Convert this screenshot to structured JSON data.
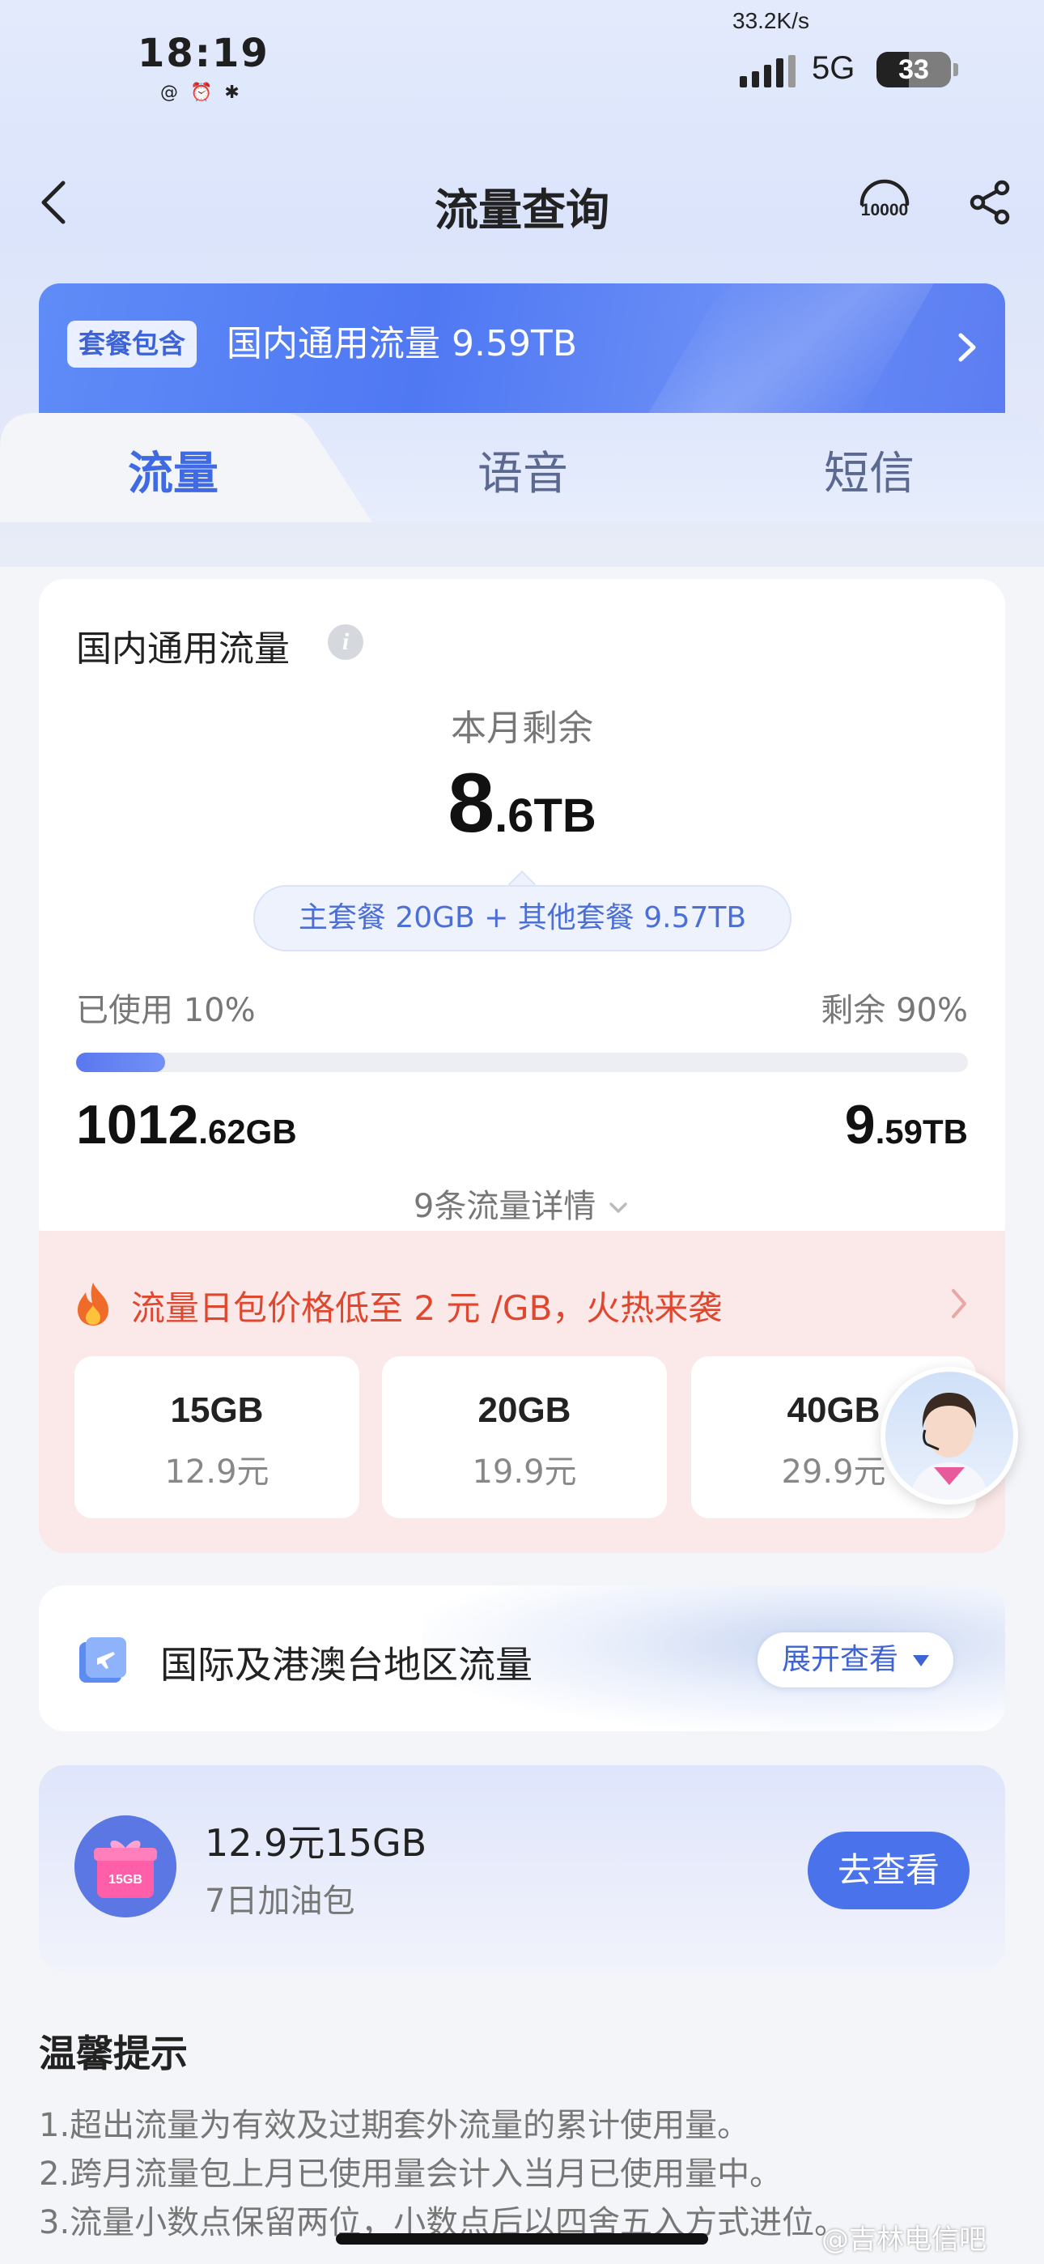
{
  "status_bar": {
    "time": "18:19",
    "left_icons": "@ ⏰ ✱",
    "speed": "33.2K/s",
    "network": "5G",
    "battery": "33"
  },
  "nav": {
    "title": "流量查询",
    "icons": [
      "back-arrow-icon",
      "customer-service-10000-icon",
      "share-icon"
    ]
  },
  "banner": {
    "tag": "套餐包含",
    "text": "国内通用流量 9.59TB"
  },
  "tabs": [
    {
      "label": "流量",
      "active": true
    },
    {
      "label": "语音",
      "active": false
    },
    {
      "label": "短信",
      "active": false
    }
  ],
  "usage_card": {
    "title": "国内通用流量",
    "remaining_label": "本月剩余",
    "remaining_int": "8",
    "remaining_rest": ".6TB",
    "breakdown": "主套餐 20GB + 其他套餐 9.57TB",
    "used_label": "已使用 10%",
    "remain_label": "剩余 90%",
    "used_fraction": 0.1,
    "used_int": "1012",
    "used_rest": ".62GB",
    "total_int": "9",
    "total_rest": ".59TB",
    "details_link": "9条流量详情"
  },
  "promo": {
    "text": "流量日包价格低至 2 元 /GB，火热来袭",
    "packages": [
      {
        "size": "15GB",
        "price": "12.9元"
      },
      {
        "size": "20GB",
        "price": "19.9元"
      },
      {
        "size": "40GB",
        "price": "29.9元"
      }
    ]
  },
  "international": {
    "title": "国际及港澳台地区流量",
    "button": "展开查看"
  },
  "booster": {
    "title": "12.9元15GB",
    "subtitle": "7日加油包",
    "icon_label": "15GB",
    "button": "去查看"
  },
  "tips": {
    "title": "温馨提示",
    "items": [
      "1.超出流量为有效及过期套外流量的累计使用量。",
      "2.跨月流量包上月已使用量会计入当月已使用量中。",
      "3.流量小数点保留两位，小数点后以四舍五入方式进位。"
    ]
  },
  "watermark": "@吉林电信吧",
  "colors": {
    "accent": "#4a72ea",
    "promo_bg": "#fbe9e9",
    "promo_text": "#e0472f"
  }
}
